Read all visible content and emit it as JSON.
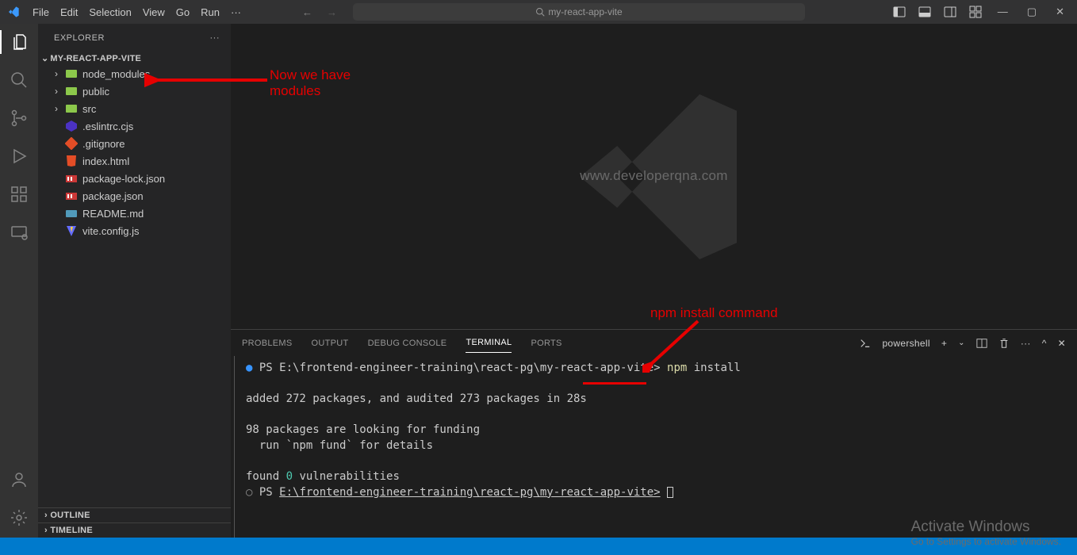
{
  "menu": [
    "File",
    "Edit",
    "Selection",
    "View",
    "Go",
    "Run"
  ],
  "search_placeholder": "my-react-app-vite",
  "sidebar": {
    "title": "EXPLORER",
    "project": "MY-REACT-APP-VITE",
    "items": [
      {
        "type": "folder",
        "name": "node_modules",
        "icon": "node",
        "chev": ">"
      },
      {
        "type": "folder",
        "name": "public",
        "icon": "node",
        "chev": ">"
      },
      {
        "type": "folder",
        "name": "src",
        "icon": "node",
        "chev": ">"
      },
      {
        "type": "file",
        "name": ".eslintrc.cjs",
        "icon": "eslint"
      },
      {
        "type": "file",
        "name": ".gitignore",
        "icon": "git"
      },
      {
        "type": "file",
        "name": "index.html",
        "icon": "html"
      },
      {
        "type": "file",
        "name": "package-lock.json",
        "icon": "npm"
      },
      {
        "type": "file",
        "name": "package.json",
        "icon": "npm"
      },
      {
        "type": "file",
        "name": "README.md",
        "icon": "md"
      },
      {
        "type": "file",
        "name": "vite.config.js",
        "icon": "vite"
      }
    ],
    "outline": "OUTLINE",
    "timeline": "TIMELINE"
  },
  "watermark_url": "www.developerqna.com",
  "panel": {
    "tabs": [
      "PROBLEMS",
      "OUTPUT",
      "DEBUG CONSOLE",
      "TERMINAL",
      "PORTS"
    ],
    "active_tab": "TERMINAL",
    "shell": "powershell"
  },
  "terminal": {
    "prompt1_prefix": "PS ",
    "prompt1_path": "E:\\frontend-engineer-training\\react-pg\\my-react-app-vite>",
    "cmd_npm": "npm",
    "cmd_rest": " install",
    "line_added": "added 272 packages, and audited 273 packages in 28s",
    "line_funding1": "98 packages are looking for funding",
    "line_funding2": "  run `npm fund` for details",
    "line_vuln_prefix": "found ",
    "line_vuln_num": "0",
    "line_vuln_suffix": " vulnerabilities",
    "prompt2_prefix": "PS ",
    "prompt2_path": "E:\\frontend-engineer-training\\react-pg\\my-react-app-vite>"
  },
  "annotations": {
    "modules": "Now we have\nmodules",
    "npm_cmd": "npm install command"
  },
  "activate": {
    "title": "Activate Windows",
    "subtitle": "Go to Settings to activate Windows."
  }
}
